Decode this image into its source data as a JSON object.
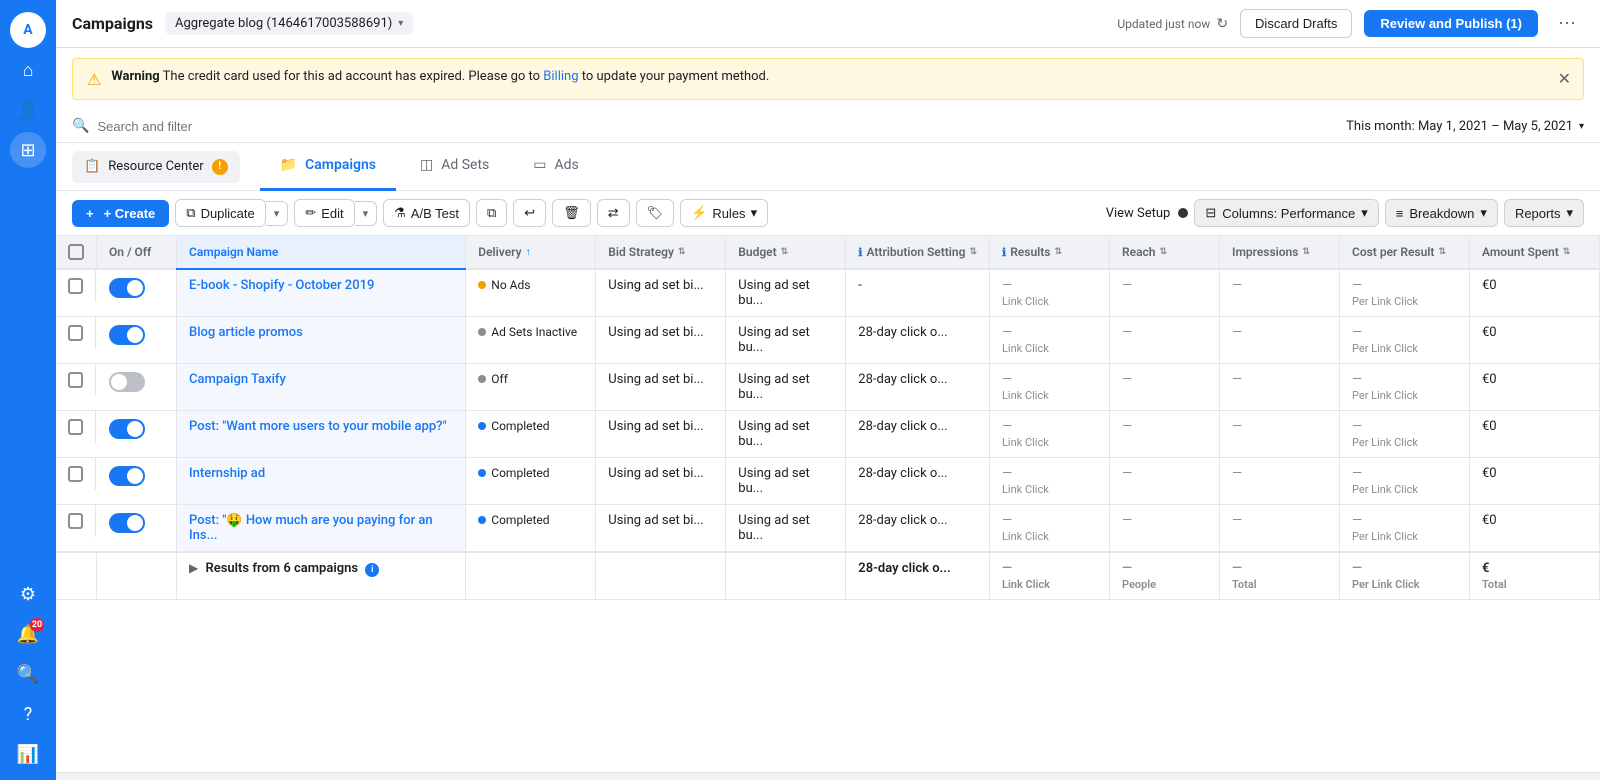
{
  "app": {
    "title": "Campaigns",
    "account": "Aggregate blog (1464617003588691)",
    "updated": "Updated just now",
    "discard_label": "Discard Drafts",
    "publish_label": "Review and Publish (1)",
    "more_icon": "⋯"
  },
  "warning": {
    "title": "Warning",
    "message": "The credit card used for this ad account has expired. Please go to ",
    "link_text": "Billing",
    "message_end": " to update your payment method."
  },
  "search": {
    "placeholder": "Search and filter",
    "date_range": "This month: May 1, 2021 – May 5, 2021"
  },
  "nav": {
    "resource_center": "Resource Center",
    "tabs": [
      {
        "id": "campaigns",
        "label": "Campaigns",
        "active": true
      },
      {
        "id": "adsets",
        "label": "Ad Sets",
        "active": false
      },
      {
        "id": "ads",
        "label": "Ads",
        "active": false
      }
    ]
  },
  "toolbar": {
    "create_label": "+ Create",
    "duplicate_label": "Duplicate",
    "edit_label": "Edit",
    "ab_test_label": "A/B Test",
    "rules_label": "Rules",
    "view_setup_label": "View Setup",
    "columns_label": "Columns: Performance",
    "breakdown_label": "Breakdown",
    "reports_label": "Reports"
  },
  "table": {
    "headers": [
      {
        "id": "checkbox",
        "label": ""
      },
      {
        "id": "onoff",
        "label": "On / Off"
      },
      {
        "id": "name",
        "label": "Campaign Name",
        "active": true
      },
      {
        "id": "delivery",
        "label": "Delivery",
        "sort": "asc"
      },
      {
        "id": "bid",
        "label": "Bid Strategy"
      },
      {
        "id": "budget",
        "label": "Budget"
      },
      {
        "id": "attr",
        "label": "Attribution Setting",
        "info": true
      },
      {
        "id": "results",
        "label": "Results",
        "info": true
      },
      {
        "id": "reach",
        "label": "Reach"
      },
      {
        "id": "impressions",
        "label": "Impressions"
      },
      {
        "id": "cpr",
        "label": "Cost per Result"
      },
      {
        "id": "amount",
        "label": "Amount Spent"
      }
    ],
    "rows": [
      {
        "id": 1,
        "on": true,
        "name": "E-book - Shopify - October 2019",
        "delivery": "No Ads",
        "delivery_dot": "orange",
        "bid": "Using ad set bi...",
        "budget": "Using ad set bu...",
        "attr": "-",
        "attr_sub": "",
        "results": "—",
        "results_sub": "Link Click",
        "reach": "—",
        "reach_sub": "",
        "impressions": "—",
        "impressions_sub": "",
        "cpr": "—",
        "cpr_sub": "Per Link Click",
        "amount": "€0",
        "amount_sub": ""
      },
      {
        "id": 2,
        "on": true,
        "name": "Blog article promos",
        "delivery": "Ad Sets Inactive",
        "delivery_dot": "gray",
        "bid": "Using ad set bi...",
        "budget": "Using ad set bu...",
        "attr": "28-day click o...",
        "attr_sub": "",
        "results": "—",
        "results_sub": "Link Click",
        "reach": "—",
        "reach_sub": "",
        "impressions": "—",
        "impressions_sub": "",
        "cpr": "—",
        "cpr_sub": "Per Link Click",
        "amount": "€0",
        "amount_sub": ""
      },
      {
        "id": 3,
        "on": false,
        "name": "Campaign Taxify",
        "delivery": "Off",
        "delivery_dot": "gray",
        "bid": "Using ad set bi...",
        "budget": "Using ad set bu...",
        "attr": "28-day click o...",
        "attr_sub": "",
        "results": "—",
        "results_sub": "Link Click",
        "reach": "—",
        "reach_sub": "",
        "impressions": "—",
        "impressions_sub": "",
        "cpr": "—",
        "cpr_sub": "Per Link Click",
        "amount": "€0",
        "amount_sub": ""
      },
      {
        "id": 4,
        "on": true,
        "name": "Post: \"Want more users to your mobile app?\"",
        "delivery": "Completed",
        "delivery_dot": "blue",
        "bid": "Using ad set bi...",
        "budget": "Using ad set bu...",
        "attr": "28-day click o...",
        "attr_sub": "",
        "results": "—",
        "results_sub": "Link Click",
        "reach": "—",
        "reach_sub": "",
        "impressions": "—",
        "impressions_sub": "",
        "cpr": "—",
        "cpr_sub": "Per Link Click",
        "amount": "€0",
        "amount_sub": ""
      },
      {
        "id": 5,
        "on": true,
        "name": "Internship ad",
        "delivery": "Completed",
        "delivery_dot": "blue",
        "bid": "Using ad set bi...",
        "budget": "Using ad set bu...",
        "attr": "28-day click o...",
        "attr_sub": "",
        "results": "—",
        "results_sub": "Link Click",
        "reach": "—",
        "reach_sub": "",
        "impressions": "—",
        "impressions_sub": "",
        "cpr": "—",
        "cpr_sub": "Per Link Click",
        "amount": "€0",
        "amount_sub": ""
      },
      {
        "id": 6,
        "on": true,
        "name": "Post: \"🤑 How much are you paying for an Ins...",
        "delivery": "Completed",
        "delivery_dot": "blue",
        "bid": "Using ad set bi...",
        "budget": "Using ad set bu...",
        "attr": "28-day click o...",
        "attr_sub": "",
        "results": "—",
        "results_sub": "Link Click",
        "reach": "—",
        "reach_sub": "",
        "impressions": "—",
        "impressions_sub": "",
        "cpr": "—",
        "cpr_sub": "Per Link Click",
        "amount": "€0",
        "amount_sub": ""
      }
    ],
    "summary": {
      "label": "Results from 6 campaigns",
      "attr": "28-day click o...",
      "results": "—",
      "results_sub": "Link Click",
      "reach": "—",
      "reach_sub": "People",
      "impressions": "—",
      "impressions_sub": "Total",
      "cpr": "—",
      "cpr_sub": "Per Link Click",
      "amount": "€",
      "amount_sub": "Total"
    }
  },
  "sidebar": {
    "icons": [
      {
        "id": "menu",
        "symbol": "☰"
      },
      {
        "id": "home",
        "symbol": "⌂"
      },
      {
        "id": "user",
        "symbol": "👤"
      },
      {
        "id": "grid",
        "symbol": "⊞"
      }
    ]
  }
}
